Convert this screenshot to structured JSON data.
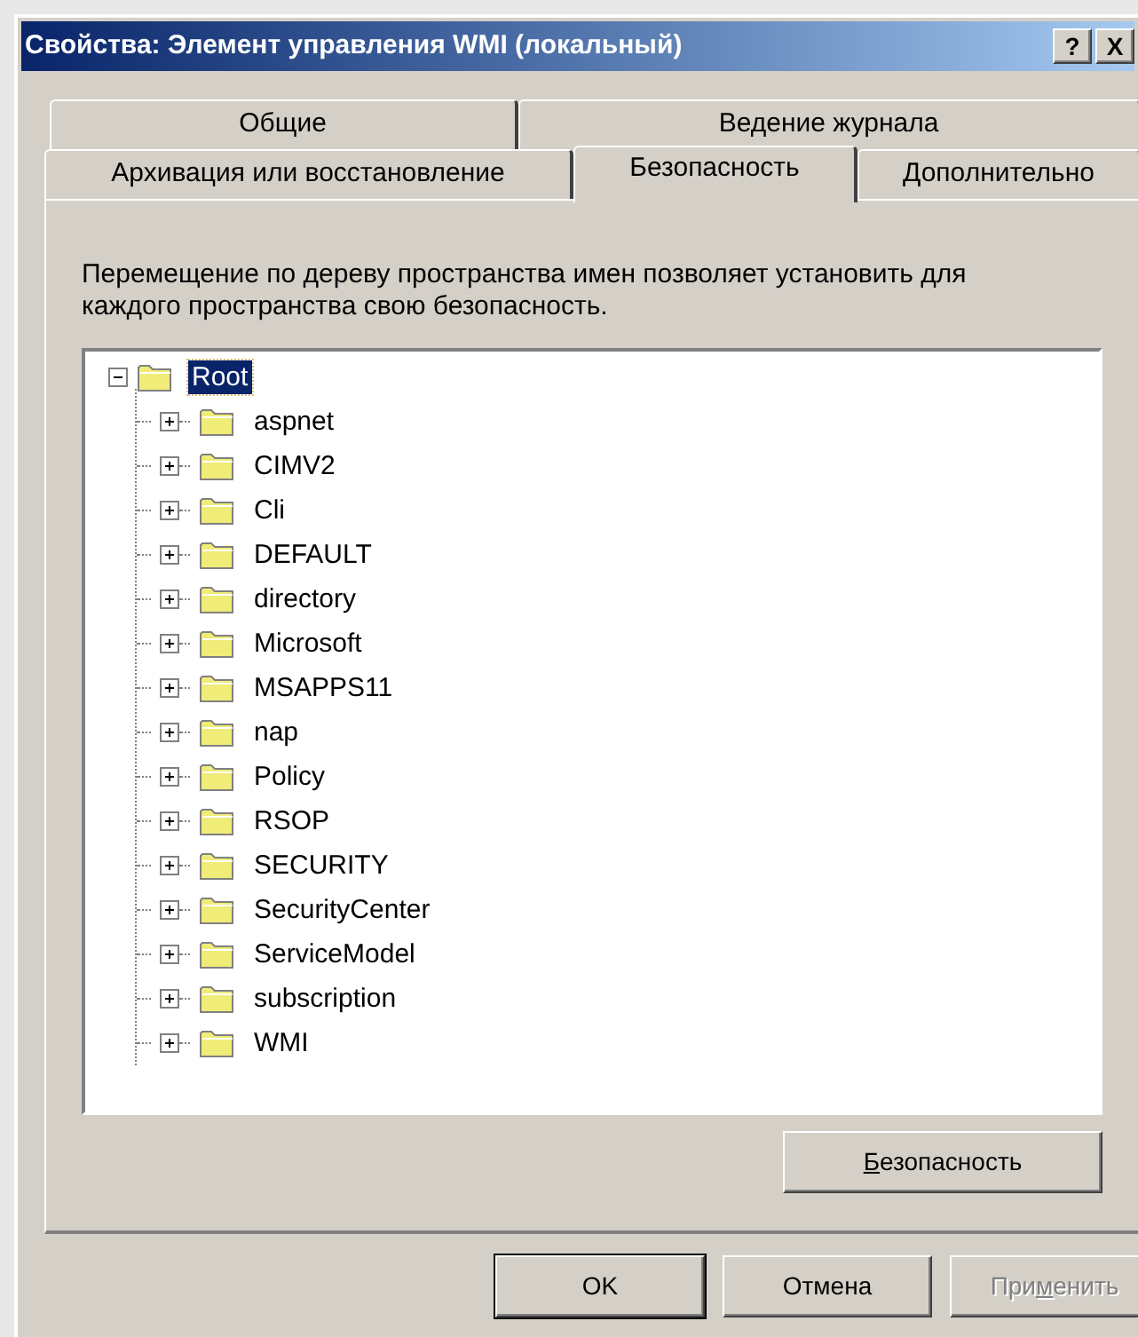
{
  "window": {
    "title": "Свойства: Элемент управления WMI (локальный)",
    "help_button": "?",
    "close_button": "X"
  },
  "tab_rows": [
    [
      {
        "label": "Общие",
        "selected": false
      },
      {
        "label": "Ведение журнала",
        "selected": false
      }
    ],
    [
      {
        "label": "Архивация или восстановление",
        "selected": false
      },
      {
        "label": "Безопасность",
        "selected": true
      },
      {
        "label": "Дополнительно",
        "selected": false
      }
    ]
  ],
  "description": "Перемещение по дереву пространства имен позволяет установить для каждого пространства свою безопасность.",
  "tree": [
    {
      "label": "Root",
      "expanded": true,
      "selected": true,
      "children": [
        {
          "label": "aspnet",
          "expanded": false,
          "selected": false
        },
        {
          "label": "CIMV2",
          "expanded": false,
          "selected": false
        },
        {
          "label": "Cli",
          "expanded": false,
          "selected": false
        },
        {
          "label": "DEFAULT",
          "expanded": false,
          "selected": false
        },
        {
          "label": "directory",
          "expanded": false,
          "selected": false
        },
        {
          "label": "Microsoft",
          "expanded": false,
          "selected": false
        },
        {
          "label": "MSAPPS11",
          "expanded": false,
          "selected": false
        },
        {
          "label": "nap",
          "expanded": false,
          "selected": false
        },
        {
          "label": "Policy",
          "expanded": false,
          "selected": false
        },
        {
          "label": "RSOP",
          "expanded": false,
          "selected": false
        },
        {
          "label": "SECURITY",
          "expanded": false,
          "selected": false
        },
        {
          "label": "SecurityCenter",
          "expanded": false,
          "selected": false
        },
        {
          "label": "ServiceModel",
          "expanded": false,
          "selected": false
        },
        {
          "label": "subscription",
          "expanded": false,
          "selected": false
        },
        {
          "label": "WMI",
          "expanded": false,
          "selected": false
        }
      ]
    }
  ],
  "security_button": {
    "access_key": "Б",
    "after": "езопасность",
    "disabled": false
  },
  "buttons": [
    {
      "before": "OK",
      "disabled": false,
      "default": true
    },
    {
      "before": "Отмена",
      "disabled": false,
      "default": false
    },
    {
      "before": "При",
      "access_key": "м",
      "after": "енить",
      "disabled": true,
      "default": false
    }
  ]
}
